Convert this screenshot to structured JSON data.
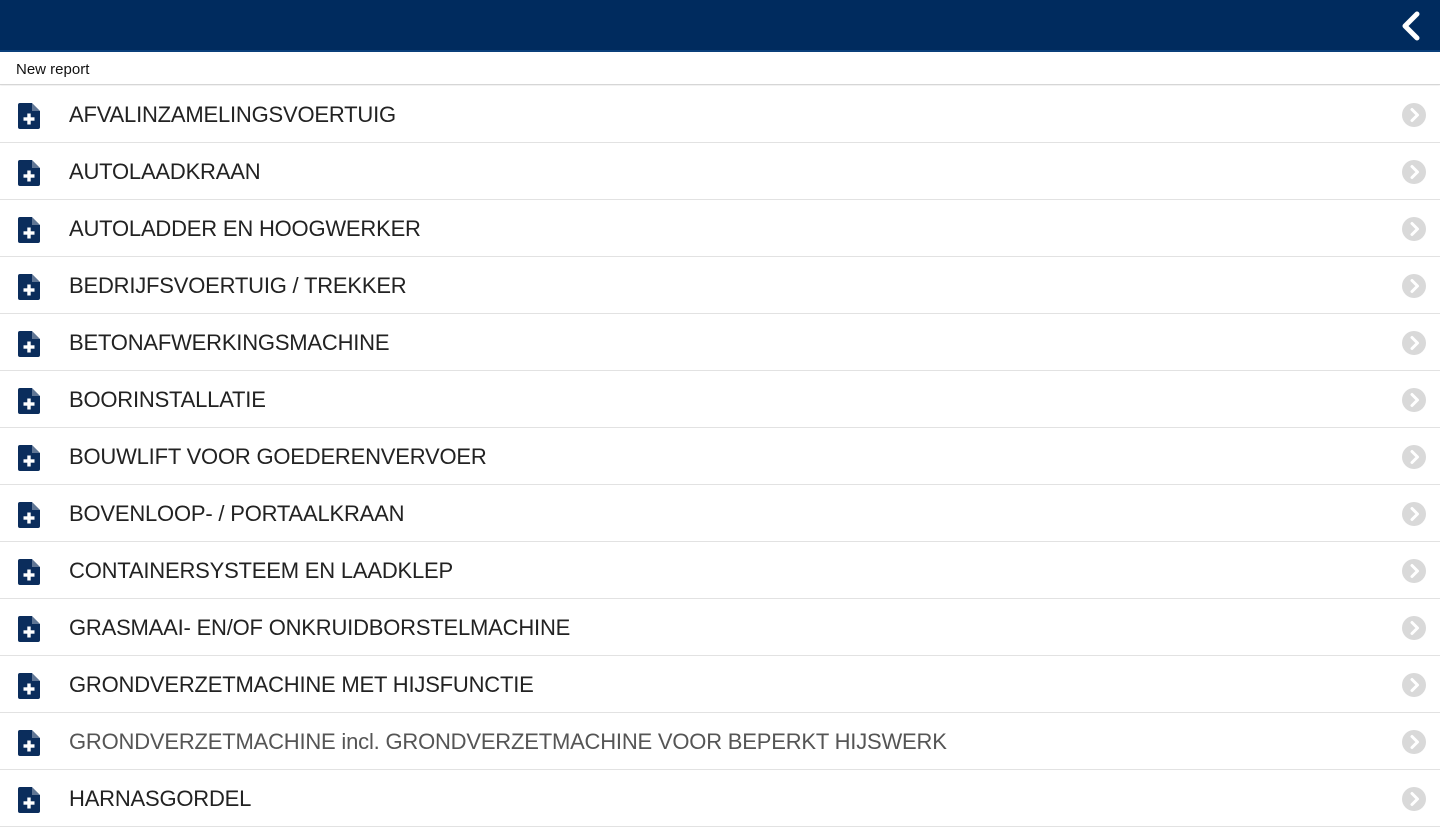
{
  "header": {
    "back_icon": "chevron-left-icon",
    "bg_color": "#002b5e"
  },
  "subheader": {
    "title": "New report"
  },
  "list": {
    "item_icon": "file-plus-icon",
    "chevron_icon": "circle-chevron-right-icon",
    "items": [
      {
        "label": "AFVALINZAMELINGSVOERTUIG"
      },
      {
        "label": "AUTOLAADKRAAN"
      },
      {
        "label": "AUTOLADDER EN HOOGWERKER"
      },
      {
        "label": "BEDRIJFSVOERTUIG / TREKKER"
      },
      {
        "label": "BETONAFWERKINGSMACHINE"
      },
      {
        "label": "BOORINSTALLATIE"
      },
      {
        "label": "BOUWLIFT VOOR GOEDERENVERVOER"
      },
      {
        "label": "BOVENLOOP- / PORTAALKRAAN"
      },
      {
        "label": "CONTAINERSYSTEEM EN LAADKLEP"
      },
      {
        "label": "GRASMAAI- EN/OF ONKRUIDBORSTELMACHINE"
      },
      {
        "label": "GRONDVERZETMACHINE MET HIJSFUNCTIE"
      },
      {
        "label": "GRONDVERZETMACHINE incl. GRONDVERZETMACHINE VOOR BEPERKT HIJSWERK"
      },
      {
        "label": "HARNASGORDEL"
      }
    ]
  }
}
